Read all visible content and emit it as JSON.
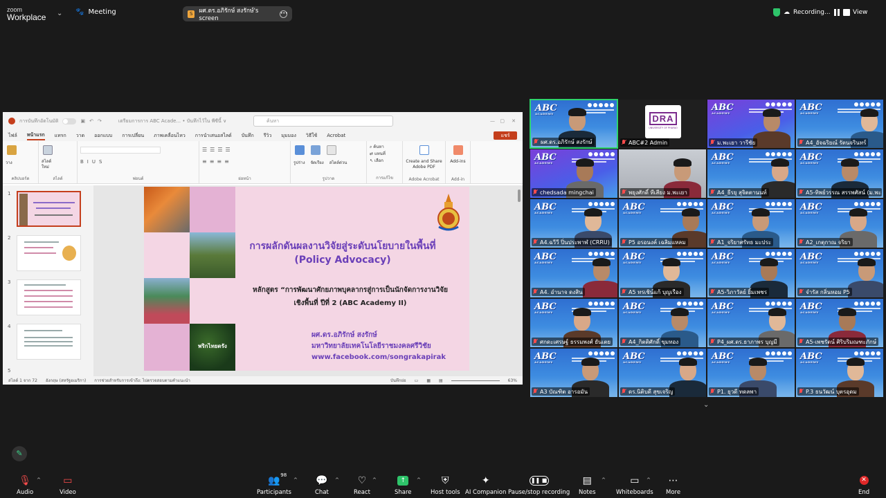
{
  "topbar": {
    "brand_top": "zoom",
    "brand_bottom": "Workplace",
    "meeting_label": "Meeting",
    "share_label": "ผศ.ดร.อภิรักษ์ สงรักษ์'s screen",
    "share_badge": "S",
    "recording_label": "Recording...",
    "view_label": "View"
  },
  "ppt": {
    "autosave_label": "การบันทึกอัตโนมัติ",
    "file_title": "เตรียมการการ ABC Acade... • บันทึกไว้ใน พีซีนี้ ∨",
    "search_placeholder": "ค้นหา",
    "menu": [
      "ไฟล์",
      "หน้าแรก",
      "แทรก",
      "วาด",
      "ออกแบบ",
      "การเปลี่ยน",
      "ภาพเคลื่อนไหว",
      "การนำเสนอสไลด์",
      "บันทึก",
      "รีวิว",
      "มุมมอง",
      "วิธีใช้",
      "Acrobat"
    ],
    "share_btn": "แชร์",
    "ribbon_groups": [
      "คลิปบอร์ด",
      "สไลด์",
      "ฟอนต์",
      "ย่อหน้า",
      "รูปวาด",
      "การแก้ไข",
      "Adobe Acrobat",
      "Add-in"
    ],
    "ribbon_labels": {
      "paste": "วาง",
      "new_slide": "สไลด์ใหม่",
      "shapes": "รูปร่าง",
      "arrange": "จัดเรียง",
      "quick_styles": "สไตล์ด่วน",
      "find": "ค้นหา",
      "replace": "แทนที่",
      "select": "เลือก",
      "adobe_pdf": "Create and Share Adobe PDF",
      "addins": "Add-ins"
    },
    "thumb_numbers": [
      "1",
      "2",
      "3",
      "4",
      "5"
    ],
    "slide": {
      "title_line1": "การผลักดันผลงานวิจัยสู่ระดับนโยบายในพื้นที่",
      "title_line2": "(Policy Advocacy)",
      "sub_line1": "หลักสูตร “การพัฒนาศักยภาพบุคลากรสู่การเป็นนักจัดการงานวิจัย",
      "sub_line2": "เชิงพื้นที่ ปีที่ 2 (ABC Academy II)",
      "author": "ผศ.ดร.อภิรักษ์ สงรักษ์",
      "university": "มหาวิทยาลัยเทคโนโลยีราชมงคลศรีวิชัย",
      "url": "www.facebook.com/songrakapirak",
      "photo_caption": "พริกไทยตรัง"
    },
    "status": {
      "slide_count": "สไลด์ 1 จาก 72",
      "language": "อังกฤษ (สหรัฐอเมริกา)",
      "accessibility": "การช่วยสำหรับการเข้าถึง: ไปตรวจสอบตามคำแนะนำ",
      "notes": "บันทึกย่อ",
      "zoom": "63%"
    }
  },
  "gallery": [
    {
      "name": "ผศ.ดร.อภิรักษ์ สงรักษ์",
      "bg": "abc",
      "active": true
    },
    {
      "name": "ABC#2 Admin",
      "bg": "dark"
    },
    {
      "name": "ม.พะเยา วารีชัย",
      "bg": "purple"
    },
    {
      "name": "A4_อัจฉริยณ์ รัตนจรินทร์",
      "bg": "abc"
    },
    {
      "name": "chedsada mingchai",
      "bg": "purple"
    },
    {
      "name": "พยุงศักดิ์ ทีเสียง ม.พะเยา",
      "bg": "office"
    },
    {
      "name": "A4_ธีรยุ สุจิตตานนท์",
      "bg": "abc"
    },
    {
      "name": "A5-ทิพย์วรรณ สรรพศัสน์ (ม.พะ...",
      "bg": "abc"
    },
    {
      "name": "A4.ฉวีวี ปิ่นประพาฬ (CRRU)",
      "bg": "abc"
    },
    {
      "name": "P5 อรอนงค์ เฉลิมแหลม",
      "bg": "abc"
    },
    {
      "name": "A1_จริยาศรัทธ มะประ",
      "bg": "abc"
    },
    {
      "name": "A2_เกตุกาณ จริยา",
      "bg": "abc"
    },
    {
      "name": "A4. อำนาจ ดงสิน",
      "bg": "abc"
    },
    {
      "name": "A5 ทรเชิน์แก้ บุญเรือง",
      "bg": "abc"
    },
    {
      "name": "A5-วิภาวัลย์ ยิ้มเพชร",
      "bg": "abc"
    },
    {
      "name": "จำรัส กลิ่นหอม P5",
      "bg": "abc"
    },
    {
      "name": "ศกดะเศรษฐ์ ธรรมพงศ์ ยันเตย",
      "bg": "abc"
    },
    {
      "name": "A4_กิตติศักดิ์ ขุมทอง",
      "bg": "abc"
    },
    {
      "name": "P4_ผศ.ดร.ธาภาพร บุญมี",
      "bg": "abc"
    },
    {
      "name": "A5-เพชรัตน์ ศิริบริมณฑะภักษ์",
      "bg": "abc"
    },
    {
      "name": "A3 บัณฑิต อารอมัน",
      "bg": "abc"
    },
    {
      "name": "ดร.นิติบดี สุขเจริญ",
      "bg": "abc"
    },
    {
      "name": "P1. ยุวดี ทดลพา",
      "bg": "abc"
    },
    {
      "name": "P.3 ธนวัฒน์ บุตรอุดม",
      "bg": "abc"
    }
  ],
  "toolbar": {
    "audio": "Audio",
    "video": "Video",
    "participants": "Participants",
    "participants_count": "98",
    "chat": "Chat",
    "react": "React",
    "share": "Share",
    "host_tools": "Host tools",
    "ai_companion": "AI Companion",
    "pause_recording": "Pause/stop recording",
    "notes": "Notes",
    "whiteboards": "Whiteboards",
    "more": "More",
    "end": "End"
  },
  "colors": {
    "accent_green": "#2ed46e",
    "slide_purple": "#6a3fb8",
    "ppt_red": "#c43e1c",
    "end_red": "#e02828"
  }
}
